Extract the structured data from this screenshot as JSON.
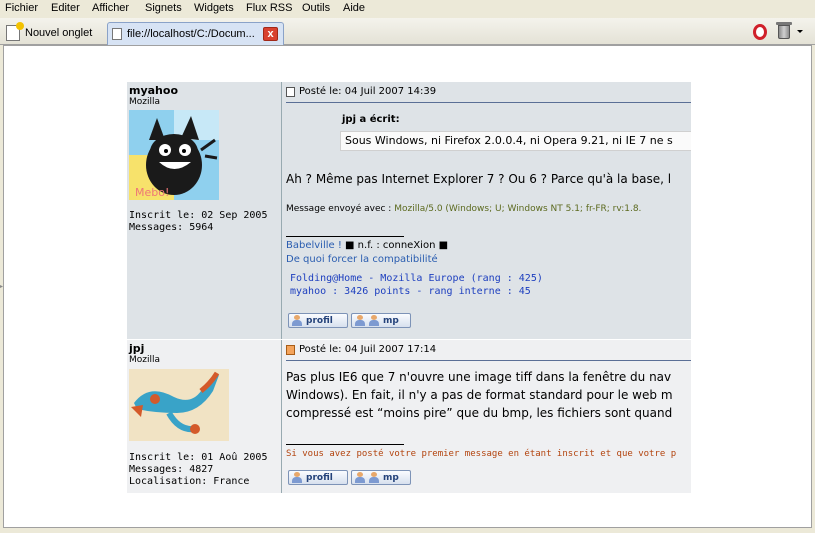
{
  "menu": [
    "Fichier",
    "Editer",
    "Afficher",
    "Signets",
    "Widgets",
    "Flux RSS",
    "Outils",
    "Aide"
  ],
  "tabs": {
    "new_tab_label": "Nouvel onglet",
    "active_tab_title": "file://localhost/C:/Docum...",
    "close_glyph": "x"
  },
  "icons": [
    "new-tab-icon",
    "page-icon",
    "close-icon",
    "opera-icon",
    "trash-icon",
    "dropdown-arrow-icon",
    "post-icon",
    "profile-button-icon",
    "mp-button-icon"
  ],
  "posts": [
    {
      "username": "myahoo",
      "rank": "Mozilla",
      "info": [
        "Inscrit le: 02 Sep 2005",
        "Messages: 5964"
      ],
      "header": "Posté le: 04 Juil 2007 14:39",
      "quote_author": "jpj a écrit:",
      "quote_text": "Sous Windows, ni Firefox 2.0.0.4, ni Opera 9.21, ni IE 7 ne s",
      "body": "Ah ? Même pas Internet Explorer 7 ? Ou 6 ? Parce qu'à la base, l",
      "ua_prefix": "Message envoyé avec :",
      "ua_value": "Mozilla/5.0 (Windows; U; Windows NT 5.1; fr-FR; rv:1.8.",
      "sig_link1": "Babelville !",
      "sig_link1_rest": "■ n.f. : conneXion ■",
      "sig_link2": "De quoi forcer la compatibilité",
      "sig_mono": [
        "Folding@Home - Mozilla Europe (rang : 425)",
        "myahoo : 3426 points - rang interne : 45"
      ],
      "btn_profil": "profil",
      "btn_mp": "mp"
    },
    {
      "username": "jpj",
      "rank": "Mozilla",
      "info": [
        "Inscrit le: 01 Aoû 2005",
        "Messages: 4827",
        "Localisation: France"
      ],
      "header": "Posté le: 04 Juil 2007 17:14",
      "body_lines": [
        "Pas plus IE6 que 7 n'ouvre une image tiff dans la fenêtre du nav",
        "Windows). En fait, il n'y a pas de format standard pour le web m",
        "compressé est “moins pire” que du bmp, les fichiers sont quand"
      ],
      "sig_red": "Si vous avez posté votre premier message en étant inscrit et que votre p",
      "btn_profil": "profil",
      "btn_mp": "mp"
    }
  ],
  "colors": {
    "row_dark": "#dee3e7",
    "row_light": "#eff0f2",
    "link": "#2a5db0",
    "signature_blue": "#1d3fbf",
    "signature_red": "#b3440f",
    "ua_olive": "#5c6a1f"
  }
}
